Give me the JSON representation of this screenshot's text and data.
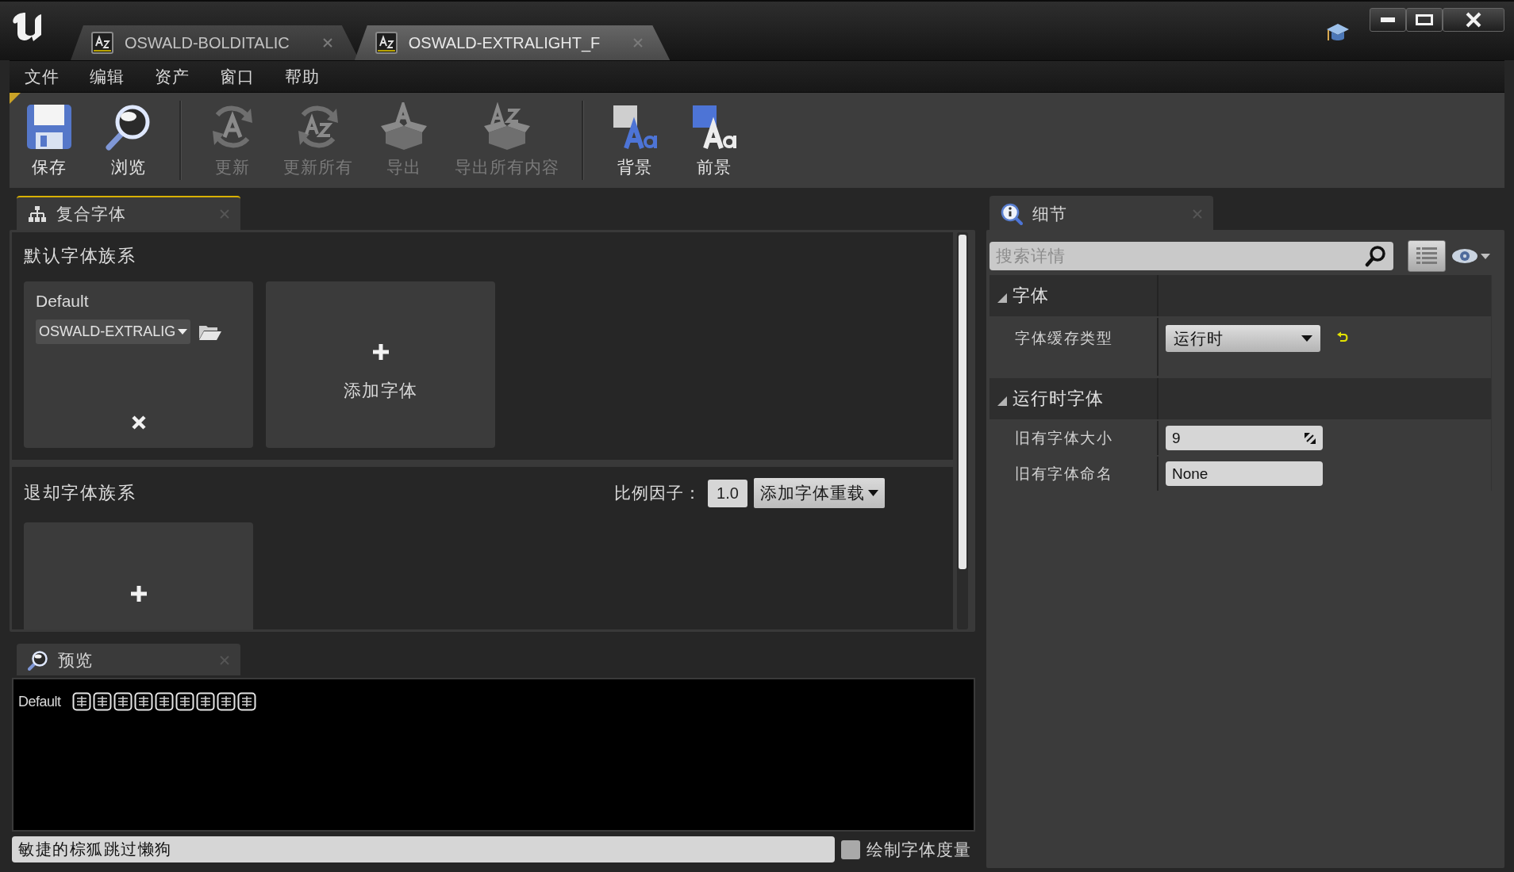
{
  "window": {
    "tabs": [
      {
        "label": "OSWALD-BOLDITALIC",
        "selected": false
      },
      {
        "label": "OSWALD-EXTRALIGHT_F",
        "selected": true
      }
    ]
  },
  "menu": [
    {
      "label": "文件"
    },
    {
      "label": "编辑"
    },
    {
      "label": "资产"
    },
    {
      "label": "窗口"
    },
    {
      "label": "帮助"
    }
  ],
  "toolbar": {
    "groups": [
      {
        "buttons": [
          {
            "kind": "save",
            "label": "保存",
            "disabled": false
          },
          {
            "kind": "browse",
            "label": "浏览",
            "disabled": false
          }
        ]
      },
      {
        "buttons": [
          {
            "kind": "update",
            "label": "更新",
            "disabled": true
          },
          {
            "kind": "update_all",
            "label": "更新所有",
            "disabled": true
          },
          {
            "kind": "export",
            "label": "导出",
            "disabled": true
          },
          {
            "kind": "export_all",
            "label": "导出所有内容",
            "disabled": true
          }
        ]
      },
      {
        "buttons": [
          {
            "kind": "background",
            "label": "背景",
            "disabled": false
          },
          {
            "kind": "foreground",
            "label": "前景",
            "disabled": false
          }
        ]
      }
    ]
  },
  "composite_font": {
    "tab": {
      "label": "复合字体",
      "focused": true
    },
    "default_family": {
      "title": "默认字体族系",
      "fonts": [
        {
          "name": "Default",
          "asset": "OSWALD-EXTRALIG"
        }
      ],
      "add_label": "添加字体"
    },
    "fallback_family": {
      "title": "退却字体族系",
      "scale_label": "比例因子：",
      "scale_value": "1.0",
      "override_label": "添加字体重载"
    }
  },
  "preview": {
    "tab": {
      "label": "预览",
      "focused": false
    },
    "row_label": "Default",
    "sample_text": "敏捷的棕狐跳过懒狗",
    "draw_metrics": {
      "label": "绘制字体度量",
      "checked": false
    }
  },
  "details": {
    "tab": {
      "label": "细节",
      "focused": false
    },
    "search": {
      "placeholder": "搜索详情"
    },
    "categories": [
      {
        "title": "字体",
        "expanded": true,
        "properties": [
          {
            "label": "字体缓存类型",
            "kind": "dropdown",
            "value": "运行时",
            "reset": true
          }
        ]
      },
      {
        "title": "运行时字体",
        "expanded": true,
        "properties": [
          {
            "label": "旧有字体大小",
            "kind": "number",
            "value": "9"
          },
          {
            "label": "旧有字体命名",
            "kind": "text",
            "value": "None"
          }
        ]
      }
    ]
  }
}
